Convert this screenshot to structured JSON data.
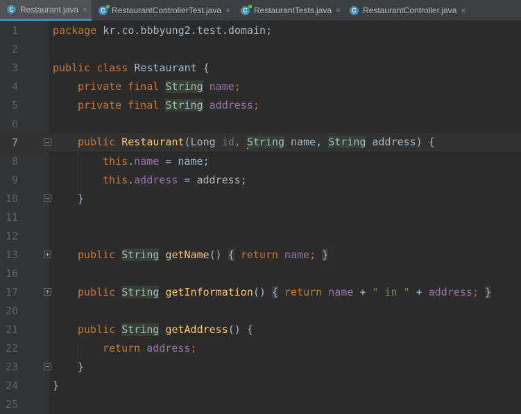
{
  "tabs": [
    {
      "label": "Restaurant.java",
      "icon": "class-icon",
      "active": true
    },
    {
      "label": "RestaurantControllerTest.java",
      "icon": "test-class-icon",
      "active": false
    },
    {
      "label": "RestaurantTests.java",
      "icon": "test-class-icon",
      "active": false
    },
    {
      "label": "RestaurantController.java",
      "icon": "class-icon",
      "active": false
    }
  ],
  "tab_close_glyph": "×",
  "line_numbers": [
    "1",
    "2",
    "3",
    "4",
    "5",
    "6",
    "7",
    "8",
    "9",
    "10",
    "11",
    "12",
    "13",
    "16",
    "17",
    "20",
    "21",
    "22",
    "23",
    "24",
    "25"
  ],
  "code": {
    "l1": {
      "kw": "package",
      "rest": " kr.co.bbbyung2.test.domain;"
    },
    "l3": {
      "kw1": "public",
      "kw2": "class",
      "name": " Restaurant {"
    },
    "l4": {
      "kw": "private final",
      "type": "String",
      "field": "name",
      "semi": ";"
    },
    "l5": {
      "kw": "private final",
      "type": "String",
      "field": "address",
      "semi": ";"
    },
    "l7": {
      "kw": "public",
      "ctor": "Restaurant",
      "open": "(Long ",
      "p1": "id",
      "comma1": ", ",
      "type2": "String",
      "p2": " name, ",
      "type3": "String",
      "p3": " address) {"
    },
    "l8": {
      "kw": "this",
      "dot": ".",
      "field": "name",
      "rest": " = name;"
    },
    "l9": {
      "kw": "this",
      "dot": ".",
      "field": "address",
      "rest": " = address;"
    },
    "l10": {
      "brace": "}"
    },
    "l13": {
      "kw": "public",
      "type": "String",
      "method": "getName",
      "parens": "()",
      "ob": "{",
      "ret": "return",
      "field": "name",
      "semi": ";",
      "cb": "}"
    },
    "l17": {
      "kw": "public",
      "type": "String",
      "method": "getInformation",
      "parens": "()",
      "ob": "{",
      "ret": "return",
      "field1": "name",
      "plus1": " + ",
      "str": "\" in \"",
      "plus2": " + ",
      "field2": "address",
      "semi": ";",
      "cb": "}"
    },
    "l21": {
      "kw": "public",
      "type": "String",
      "method": "getAddress",
      "rest": "() {"
    },
    "l22": {
      "ret": "return",
      "field": "address",
      "semi": ";"
    },
    "l23": {
      "brace": "}"
    },
    "l24": {
      "brace": "}"
    }
  },
  "colors": {
    "background": "#2b2b2b",
    "keyword": "#cc7832",
    "field": "#9876aa",
    "method": "#ffc66d",
    "string": "#6a8759",
    "text": "#a9b7c6"
  }
}
